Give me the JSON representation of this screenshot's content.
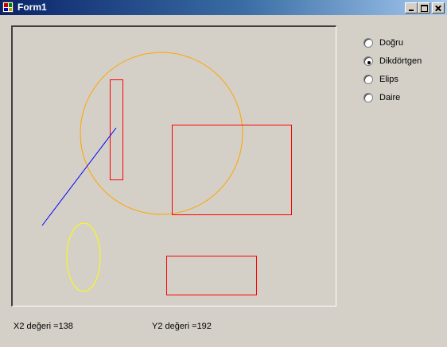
{
  "window": {
    "title": "Form1",
    "icon": "form-app-icon",
    "controls": [
      "minimize",
      "maximize",
      "close"
    ]
  },
  "colors": {
    "title_gradient_start": "#0a246a",
    "title_gradient_end": "#a6caf0",
    "face": "#d4d0c8",
    "line": "#0000ff",
    "rectangle": "#ff0000",
    "circle": "#ffa500",
    "ellipse": "#ffff00"
  },
  "shape_options": [
    {
      "label": "Doğru",
      "selected": false
    },
    {
      "label": "Dikdörtgen",
      "selected": true
    },
    {
      "label": "Elips",
      "selected": false
    },
    {
      "label": "Daire",
      "selected": false
    }
  ],
  "status": {
    "x2_text": "X2 değeri =138",
    "y2_text": "Y2 değeri =192"
  }
}
